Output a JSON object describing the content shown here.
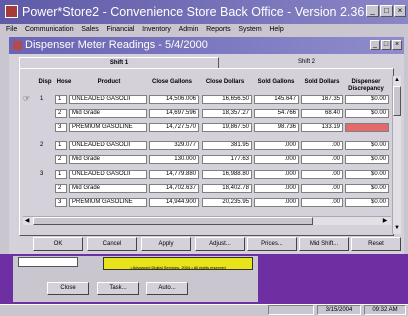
{
  "app": {
    "title": "Power*Store2 - Convenience Store Back Office - Version 2.36"
  },
  "menu": [
    "File",
    "Communication",
    "Sales",
    "Financial",
    "Inventory",
    "Admin",
    "Reports",
    "System",
    "Help"
  ],
  "window": {
    "title": "Dispenser Meter Readings - 5/4/2000",
    "tabs": [
      "Shift 1",
      "Shift 2"
    ]
  },
  "columns": {
    "disp": "Disp",
    "hose": "Hose",
    "product": "Product",
    "close_gallons": "Close Gallons",
    "close_dollars": "Close Dollars",
    "sold_gallons": "Sold Gallons",
    "sold_dollars": "Sold Dollars",
    "discrepancy": "Dispenser Discrepancy"
  },
  "rows": [
    {
      "disp": "1",
      "hose": "1",
      "product": "UNLEADED GASOLII",
      "close_gallons": "14,506.006",
      "close_dollars": "16,656.50",
      "sold_gallons": "145.647",
      "sold_dollars": "167.35",
      "discrepancy": "$0.00",
      "selected": true
    },
    {
      "disp": "",
      "hose": "2",
      "product": "Mid Grade",
      "close_gallons": "14,697.596",
      "close_dollars": "18,357.27",
      "sold_gallons": "54.766",
      "sold_dollars": "68.40",
      "discrepancy": "$0.00"
    },
    {
      "disp": "",
      "hose": "3",
      "product": "PREMIUM GASOLINE",
      "close_gallons": "14,727.570",
      "close_dollars": "19,867.50",
      "sold_gallons": "98.736",
      "sold_dollars": "133.19",
      "discrepancy": "",
      "alert": true
    },
    {
      "disp": "2",
      "hose": "1",
      "product": "UNLEADED GASOLII",
      "close_gallons": "329.077",
      "close_dollars": "381.95",
      "sold_gallons": ".000",
      "sold_dollars": ".00",
      "discrepancy": "$0.00"
    },
    {
      "disp": "",
      "hose": "2",
      "product": "Mid Grade",
      "close_gallons": "130.000",
      "close_dollars": "177.63",
      "sold_gallons": ".000",
      "sold_dollars": ".00",
      "discrepancy": "$0.00"
    },
    {
      "disp": "3",
      "hose": "1",
      "product": "UNLEADED GASOLII",
      "close_gallons": "14,779.880",
      "close_dollars": "16,988.80",
      "sold_gallons": ".000",
      "sold_dollars": ".00",
      "discrepancy": "$0.00"
    },
    {
      "disp": "",
      "hose": "2",
      "product": "Mid Grade",
      "close_gallons": "14,702.637",
      "close_dollars": "18,402.78",
      "sold_gallons": ".000",
      "sold_dollars": ".00",
      "discrepancy": "$0.00"
    },
    {
      "disp": "",
      "hose": "3",
      "product": "PREMIUM GASOLINE",
      "close_gallons": "14,944.900",
      "close_dollars": "20,235.95",
      "sold_gallons": ".000",
      "sold_dollars": ".00",
      "discrepancy": "$0.00"
    }
  ],
  "buttons": [
    "OK",
    "Cancel",
    "Apply",
    "Adjust...",
    "Prices...",
    "Mid Shift...",
    "Reset"
  ],
  "bottom": {
    "ticker": "• Advanced Digital Services, 2004 • All rights reserved",
    "buttons": [
      "Close",
      "Task...",
      "Auto..."
    ]
  },
  "status": {
    "date": "3/15/2004",
    "time": "09:32 AM"
  },
  "colors": {
    "title": "#5f5aa6",
    "alert": "#e26a6a",
    "taskbar": "#6e2fa3",
    "ticker": "#e8e31a"
  }
}
